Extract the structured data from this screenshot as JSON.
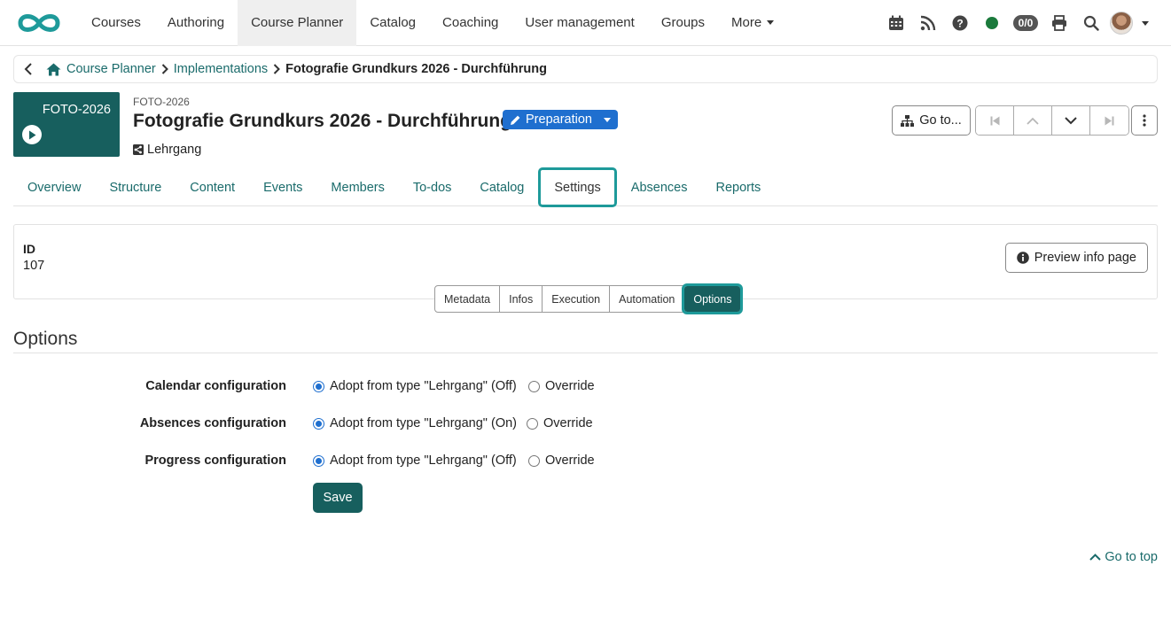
{
  "nav": {
    "items": [
      {
        "label": "Courses"
      },
      {
        "label": "Authoring"
      },
      {
        "label": "Course Planner"
      },
      {
        "label": "Catalog"
      },
      {
        "label": "Coaching"
      },
      {
        "label": "User management"
      },
      {
        "label": "Groups"
      },
      {
        "label": "More"
      }
    ],
    "active": "Course Planner",
    "badge": "0/0",
    "icons": [
      "calendar-icon",
      "rss-icon",
      "help-icon",
      "status-online-icon",
      "print-icon",
      "search-icon",
      "avatar"
    ]
  },
  "breadcrumb": {
    "items": [
      "Course Planner",
      "Implementations"
    ],
    "current": "Fotografie Grundkurs 2026 - Durchführung"
  },
  "header": {
    "thumb_label": "FOTO-2026",
    "external_ref": "FOTO-2026",
    "title": "Fotografie Grundkurs 2026 - Durchführung",
    "type": "Lehrgang",
    "status": "Preparation",
    "goto_label": "Go to..."
  },
  "tabs": [
    {
      "label": "Overview"
    },
    {
      "label": "Structure"
    },
    {
      "label": "Content"
    },
    {
      "label": "Events"
    },
    {
      "label": "Members"
    },
    {
      "label": "To-dos"
    },
    {
      "label": "Catalog"
    },
    {
      "label": "Settings"
    },
    {
      "label": "Absences"
    },
    {
      "label": "Reports"
    }
  ],
  "active_tab": "Settings",
  "info": {
    "id_label": "ID",
    "id_value": "107",
    "preview_label": "Preview info page"
  },
  "subtabs": [
    {
      "label": "Metadata"
    },
    {
      "label": "Infos"
    },
    {
      "label": "Execution"
    },
    {
      "label": "Automation"
    },
    {
      "label": "Options"
    }
  ],
  "active_subtab": "Options",
  "options": {
    "title": "Options",
    "rows": [
      {
        "label": "Calendar configuration",
        "adopt": "Adopt from type \"Lehrgang\" (Off)",
        "override": "Override",
        "selected": "adopt"
      },
      {
        "label": "Absences configuration",
        "adopt": "Adopt from type \"Lehrgang\" (On)",
        "override": "Override",
        "selected": "adopt"
      },
      {
        "label": "Progress configuration",
        "adopt": "Adopt from type \"Lehrgang\" (Off)",
        "override": "Override",
        "selected": "adopt"
      }
    ],
    "save_label": "Save"
  },
  "footer": {
    "go_to_top": "Go to top"
  },
  "colors": {
    "brand": "#175f5e",
    "accent": "#1e9a9a",
    "status": "#1f6fcf",
    "link": "#1a6b6b"
  }
}
